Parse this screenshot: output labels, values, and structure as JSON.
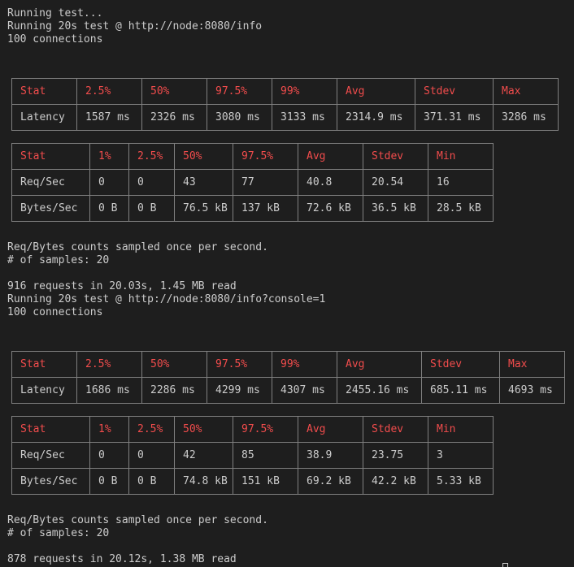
{
  "run1": {
    "header_lines": [
      "Running test...",
      "Running 20s test @ http://node:8080/info",
      "100 connections"
    ],
    "latency": {
      "headers": [
        "Stat",
        "2.5%",
        "50%",
        "97.5%",
        "99%",
        "Avg",
        "Stdev",
        "Max"
      ],
      "rows": [
        [
          "Latency",
          "1587 ms",
          "2326 ms",
          "3080 ms",
          "3133 ms",
          "2314.9 ms",
          "371.31 ms",
          "3286 ms"
        ]
      ]
    },
    "throughput": {
      "headers": [
        "Stat",
        "1%",
        "2.5%",
        "50%",
        "97.5%",
        "Avg",
        "Stdev",
        "Min"
      ],
      "rows": [
        [
          "Req/Sec",
          "0",
          "0",
          "43",
          "77",
          "40.8",
          "20.54",
          "16"
        ],
        [
          "Bytes/Sec",
          "0 B",
          "0 B",
          "76.5 kB",
          "137 kB",
          "72.6 kB",
          "36.5 kB",
          "28.5 kB"
        ]
      ]
    },
    "footer_lines": [
      "Req/Bytes counts sampled once per second.",
      "# of samples: 20"
    ],
    "summary": "916 requests in 20.03s, 1.45 MB read"
  },
  "run2": {
    "header_lines": [
      "Running 20s test @ http://node:8080/info?console=1",
      "100 connections"
    ],
    "latency": {
      "headers": [
        "Stat",
        "2.5%",
        "50%",
        "97.5%",
        "99%",
        "Avg",
        "Stdev",
        "Max"
      ],
      "rows": [
        [
          "Latency",
          "1686 ms",
          "2286 ms",
          "4299 ms",
          "4307 ms",
          "2455.16 ms",
          "685.11 ms",
          "4693 ms"
        ]
      ]
    },
    "throughput": {
      "headers": [
        "Stat",
        "1%",
        "2.5%",
        "50%",
        "97.5%",
        "Avg",
        "Stdev",
        "Min"
      ],
      "rows": [
        [
          "Req/Sec",
          "0",
          "0",
          "42",
          "85",
          "38.9",
          "23.75",
          "3"
        ],
        [
          "Bytes/Sec",
          "0 B",
          "0 B",
          "74.8 kB",
          "151 kB",
          "69.2 kB",
          "42.2 kB",
          "5.33 kB"
        ]
      ]
    },
    "footer_lines": [
      "Req/Bytes counts sampled once per second.",
      "# of samples: 20"
    ],
    "summary": "878 requests in 20.12s, 1.38 MB read"
  },
  "colors": {
    "background": "#1e1e1e",
    "text": "#cccccc",
    "header_text": "#f14c4c",
    "border": "#808080"
  }
}
